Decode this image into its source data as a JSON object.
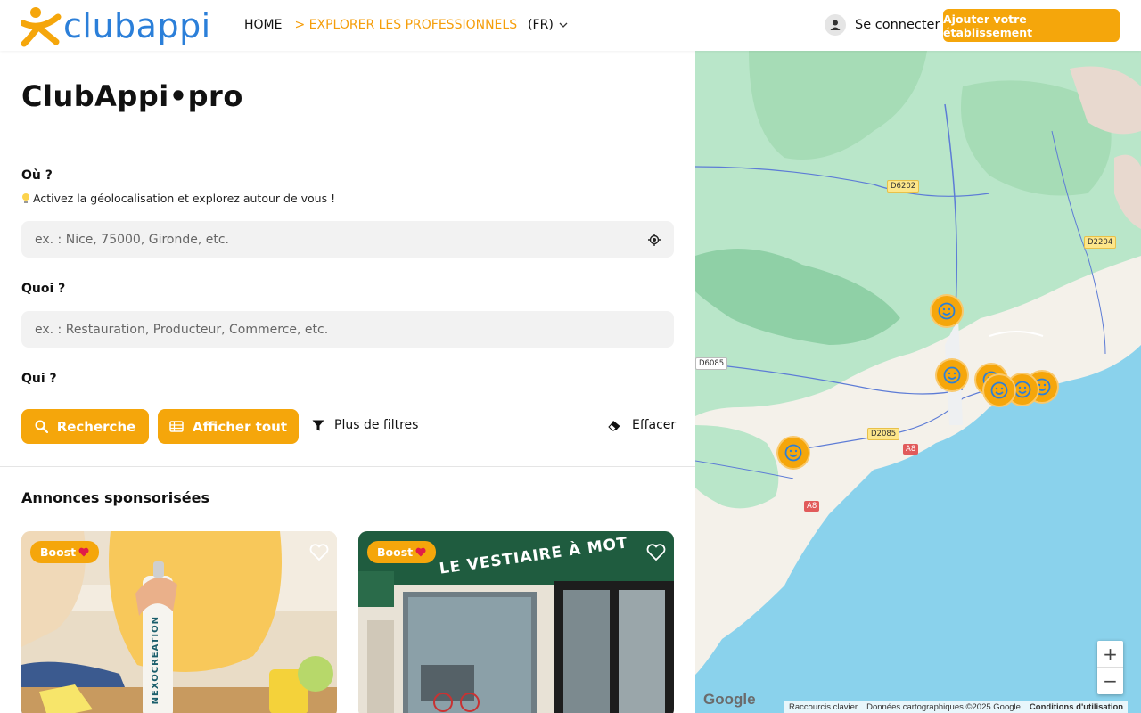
{
  "header": {
    "logo_text": "clubappi",
    "nav_home": "HOME",
    "nav_explore": "> EXPLORER LES PROFESSIONNELS",
    "nav_lang": "(FR)",
    "login_label": "Se connecter",
    "add_button": "Ajouter votre établissement"
  },
  "main": {
    "brand_title": "ClubAppi•pro",
    "where_label": "Où ?",
    "geo_hint": "Activez la géolocalisation et explorez autour de vous !",
    "where_placeholder": "ex. : Nice, 75000, Gironde, etc.",
    "what_label": "Quoi ?",
    "what_placeholder": "ex. : Restauration, Producteur, Commerce, etc.",
    "who_label": "Qui ?",
    "search_button": "Recherche",
    "show_all_button": "Afficher tout",
    "more_filters": "Plus de filtres",
    "clear_label": "Effacer",
    "sponsored_title": "Annonces sponsorisées",
    "cards": [
      {
        "badge": "Boost",
        "brand_text": "NEXOCREATION"
      },
      {
        "badge": "Boost",
        "shop_sign": "LE VESTIAIRE À MOT"
      }
    ]
  },
  "map": {
    "roads": {
      "r1": "D6202",
      "r2": "D2204",
      "r3": "D6085",
      "r4": "D2085",
      "r5": "A8",
      "r6": "A8"
    },
    "zoom_in": "+",
    "zoom_out": "−",
    "google_logo": "Google",
    "attrib_shortcuts": "Raccourcis clavier",
    "attrib_data": "Données cartographiques ©2025 Google",
    "attrib_terms": "Conditions d'utilisation"
  },
  "colors": {
    "accent": "#f5a60b",
    "logo_blue": "#2b7fd9",
    "sea": "#8ad2ec",
    "land_green": "#b9e6c9"
  }
}
